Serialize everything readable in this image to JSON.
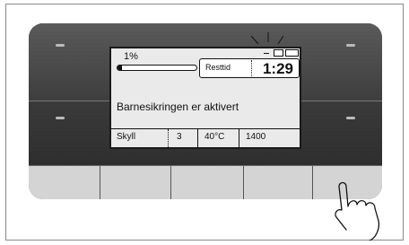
{
  "display": {
    "progress_label": "1%",
    "progress_fraction": 0.01,
    "time_label": "Resttid",
    "time_value": "1:29",
    "message": "Barnesikringen er aktivert",
    "program": "Skyll",
    "rinse_count": "3",
    "temperature": "40°C",
    "spin_speed": "1400"
  },
  "icons": [
    "dash-icon",
    "lock-icon",
    "key-icon",
    "indicator-glow-icon",
    "hand-press-icon"
  ]
}
